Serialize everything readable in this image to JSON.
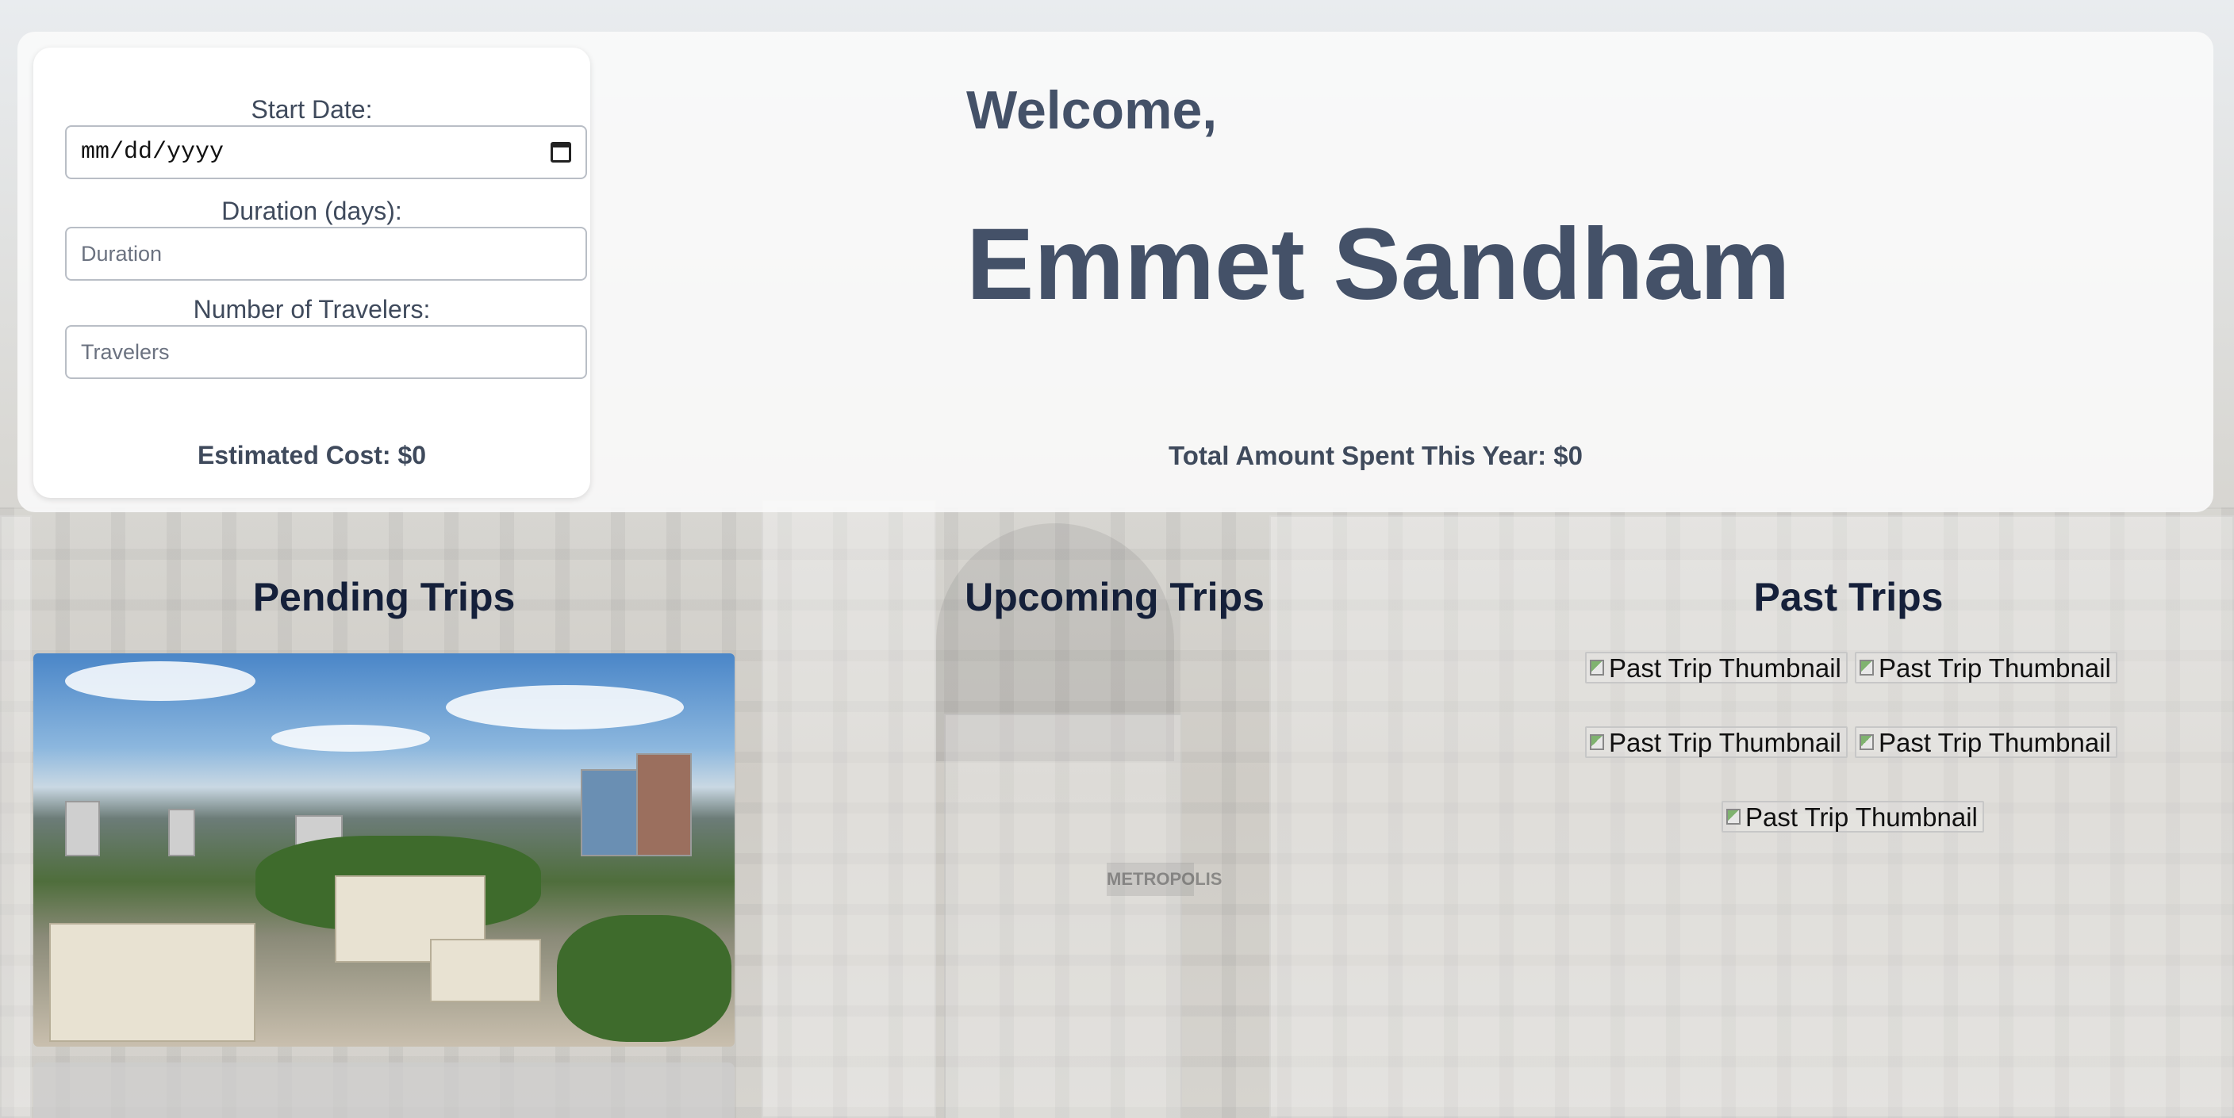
{
  "form": {
    "start_date_label": "Start Date:",
    "start_date_placeholder": "mm/dd/yyyy",
    "duration_label": "Duration (days):",
    "duration_placeholder": "Duration",
    "travelers_label": "Number of Travelers:",
    "travelers_placeholder": "Travelers",
    "estimated_cost": "Estimated Cost: $0"
  },
  "header": {
    "welcome": "Welcome,",
    "user_name": "Emmet Sandham",
    "total_spent": "Total Amount Spent This Year: $0"
  },
  "sections": {
    "pending": "Pending Trips",
    "upcoming": "Upcoming Trips",
    "past": "Past Trips"
  },
  "past_trips": {
    "thumbnails": [
      "Past Trip Thumbnail",
      "Past Trip Thumbnail",
      "Past Trip Thumbnail",
      "Past Trip Thumbnail",
      "Past Trip Thumbnail"
    ]
  },
  "background": {
    "sign_text": "METROPOLIS"
  }
}
